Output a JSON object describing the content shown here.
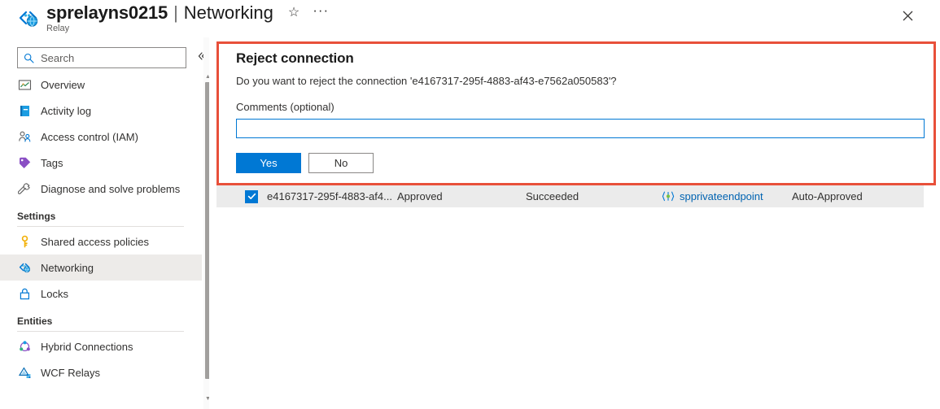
{
  "header": {
    "resource_icon": "relay-icon",
    "title": "sprelayns0215",
    "separator": "|",
    "page": "Networking",
    "subtitle": "Relay",
    "favorite_icon": "star-icon",
    "more_icon": "ellipsis-icon",
    "close_icon": "close-icon"
  },
  "sidebar": {
    "search": {
      "placeholder": "Search",
      "value": "",
      "icon": "search-icon"
    },
    "collapse_icon": "chevron-double-left-icon",
    "items": [
      {
        "label": "Overview",
        "icon": "overview-icon",
        "selected": false
      },
      {
        "label": "Activity log",
        "icon": "activity-log-icon",
        "selected": false
      },
      {
        "label": "Access control (IAM)",
        "icon": "access-control-icon",
        "selected": false
      },
      {
        "label": "Tags",
        "icon": "tag-icon",
        "selected": false
      },
      {
        "label": "Diagnose and solve problems",
        "icon": "diagnose-icon",
        "selected": false
      }
    ],
    "groups": [
      {
        "title": "Settings",
        "items": [
          {
            "label": "Shared access policies",
            "icon": "key-icon",
            "selected": false
          },
          {
            "label": "Networking",
            "icon": "networking-icon",
            "selected": true
          },
          {
            "label": "Locks",
            "icon": "lock-icon",
            "selected": false
          }
        ]
      },
      {
        "title": "Entities",
        "items": [
          {
            "label": "Hybrid Connections",
            "icon": "hybrid-connections-icon",
            "selected": false
          },
          {
            "label": "WCF Relays",
            "icon": "wcf-relays-icon",
            "selected": false
          }
        ]
      }
    ]
  },
  "dialog": {
    "title": "Reject connection",
    "question": "Do you want to reject the connection 'e4167317-295f-4883-af43-e7562a050583'?",
    "comments_label": "Comments (optional)",
    "comments_value": "",
    "comments_placeholder": "",
    "yes_label": "Yes",
    "no_label": "No"
  },
  "table": {
    "row": {
      "checked": true,
      "name": "e4167317-295f-4883-af4...",
      "connection_state": "Approved",
      "provisioning_state": "Succeeded",
      "private_endpoint_icon": "private-endpoint-icon",
      "private_endpoint": "spprivateendpoint",
      "description": "Auto-Approved"
    }
  },
  "colors": {
    "accent": "#0078d4",
    "annotation": "#e8503a",
    "link": "#0063b1",
    "selected_row": "#ebebeb",
    "selected_nav": "#edebe9"
  }
}
